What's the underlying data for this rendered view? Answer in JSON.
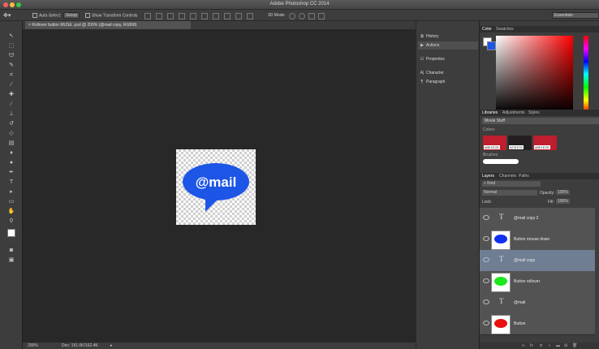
{
  "window": {
    "title": "Adobe Photoshop CC 2014"
  },
  "options_bar": {
    "auto_select_label": "Auto-Select:",
    "auto_select_value": "Group",
    "transform_label": "Show Transform Controls",
    "mode_3d_label": "3D Mode:",
    "workspace": "Essentials"
  },
  "document": {
    "tab_title": "Rollover button MUSE .psd @ 200% (@mail copy, RGB/8)",
    "artwork_text": "@mail",
    "artwork_color": "#1d55e6"
  },
  "status": {
    "zoom": "200%",
    "doc_info": "Doc: 151.0K/162.4K"
  },
  "mid_panel": {
    "items": [
      {
        "icon": "history-icon",
        "label": "History"
      },
      {
        "icon": "actions-icon",
        "label": "Actions"
      },
      {
        "icon": "properties-icon",
        "label": "Properties"
      },
      {
        "icon": "character-icon",
        "label": "Character"
      },
      {
        "icon": "paragraph-icon",
        "label": "Paragraph"
      }
    ]
  },
  "color_panel": {
    "tabs": [
      "Color",
      "Swatches"
    ],
    "foreground": "#ffffff",
    "background": "#1d55e6"
  },
  "libraries_panel": {
    "tabs": [
      "Libraries",
      "Adjustments",
      "Styles"
    ],
    "library": "Movie Stuff",
    "colors_label": "Colors",
    "swatches": [
      {
        "hex": "#BE1E2D",
        "label": "#BE1E2D"
      },
      {
        "hex": "#231F20",
        "label": "#231F20"
      },
      {
        "hex": "#BE1E2D",
        "label": "#BE1E2D"
      }
    ],
    "brushes_label": "Brushes"
  },
  "layers_panel": {
    "tabs": [
      "Layers",
      "Channels",
      "Paths"
    ],
    "filter": "Kind",
    "blend_mode": "Normal",
    "opacity_label": "Opacity:",
    "opacity": "100%",
    "lock_label": "Lock:",
    "fill_label": "Fill:",
    "fill": "100%",
    "layers": [
      {
        "name": "@mail copy 2",
        "kind": "text",
        "color": ""
      },
      {
        "name": "Button mouse down",
        "kind": "shape",
        "color": "#1030f0"
      },
      {
        "name": "@mail copy",
        "kind": "text",
        "color": "",
        "selected": true
      },
      {
        "name": "Button rollover",
        "kind": "shape",
        "color": "#1ee81e"
      },
      {
        "name": "@mail",
        "kind": "text",
        "color": ""
      },
      {
        "name": "Button",
        "kind": "shape",
        "color": "#e81010"
      }
    ]
  }
}
